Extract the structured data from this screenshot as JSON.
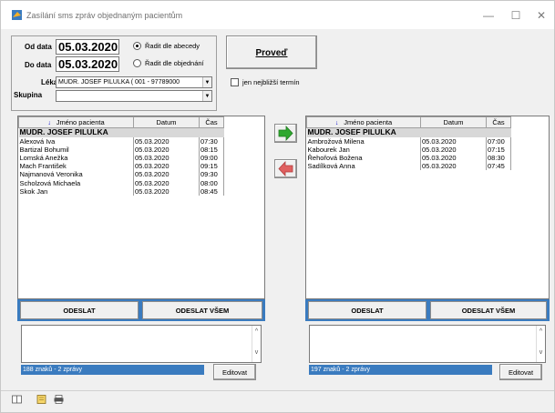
{
  "window": {
    "title": "Zasílání sms zpráv objednaným pacientům",
    "minimize_glyph": "—",
    "maximize_glyph": "☐",
    "close_glyph": "✕",
    "icon": "app-icon"
  },
  "filters": {
    "from_label": "Od data",
    "from_value": "05.03.2020",
    "to_label": "Do data",
    "to_value": "05.03.2020",
    "sort_alpha_label": "Řadit dle abecedy",
    "sort_order_label": "Řadit dle objednání",
    "sort_selected": "alpha",
    "doctor_label": "Lékař",
    "doctor_value": "MUDR. JOSEF PILULKA ( 001 - 97789000",
    "group_label": "Skupina",
    "group_value": ""
  },
  "actions": {
    "run_label": "Proveď",
    "nearest_only_label": "jen nejbližší termín",
    "nearest_only_checked": false
  },
  "left": {
    "columns": [
      "Jméno pacienta",
      "Datum",
      "Čas"
    ],
    "group_row": "MUDR. JOSEF PILULKA",
    "rows": [
      [
        "Alexová Iva",
        "05.03.2020",
        "07:30"
      ],
      [
        "Bartizal Bohumil",
        "05.03.2020",
        "08:15"
      ],
      [
        "Lomská Anežka",
        "05.03.2020",
        "09:00"
      ],
      [
        "Mach František",
        "05.03.2020",
        "09:15"
      ],
      [
        "Najmanová Veronika",
        "05.03.2020",
        "09:30"
      ],
      [
        "Scholzová Michaela",
        "05.03.2020",
        "08:00"
      ],
      [
        "Skok Jan",
        "05.03.2020",
        "08:45"
      ]
    ],
    "send_label": "ODESLAT",
    "send_all_label": "ODESLAT VŠEM",
    "message_text": "",
    "status_text": "188 znaků - 2 zprávy",
    "edit_label": "Editovat"
  },
  "right": {
    "columns": [
      "Jméno pacienta",
      "Datum",
      "Čas"
    ],
    "group_row": "MUDR. JOSEF PILULKA",
    "rows": [
      [
        "Ambrožová Milena",
        "05.03.2020",
        "07:00"
      ],
      [
        "Kabourek Jan",
        "05.03.2020",
        "07:15"
      ],
      [
        "Řehořová Božena",
        "05.03.2020",
        "08:30"
      ],
      [
        "Sadílková Anna",
        "05.03.2020",
        "07:45"
      ]
    ],
    "send_label": "ODESLAT",
    "send_all_label": "ODESLAT VŠEM",
    "message_text": "",
    "status_text": "197 znaků - 2 zprávy",
    "edit_label": "Editovat"
  },
  "transfer": {
    "move_right_icon": "arrow-right-icon",
    "move_left_icon": "arrow-left-icon"
  },
  "colors": {
    "accent_blue": "#3a7bbf",
    "arrow_green": "#2fa82f",
    "arrow_red": "#e06060"
  }
}
